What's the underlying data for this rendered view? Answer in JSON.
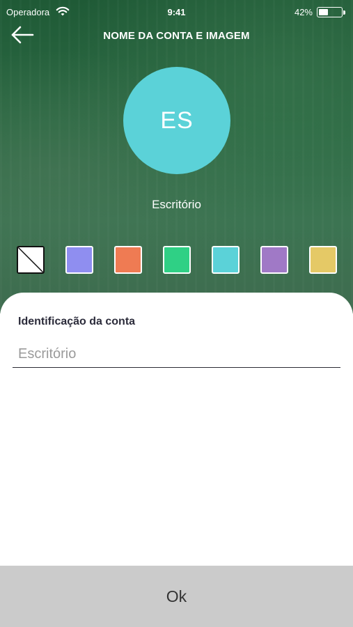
{
  "status_bar": {
    "carrier": "Operadora",
    "time": "9:41",
    "battery_percent": "42%",
    "battery_level": 0.42,
    "wifi_icon": "wifi-icon"
  },
  "header": {
    "back_icon": "arrow-left-icon",
    "title": "NOME DA CONTA E IMAGEM"
  },
  "avatar": {
    "initials": "ES",
    "color": "#5bd2d8"
  },
  "account_name": "Escritório",
  "colors": {
    "options": [
      {
        "name": "none",
        "hex": "#ffffff"
      },
      {
        "name": "periwinkle",
        "hex": "#8f8ef0"
      },
      {
        "name": "orange",
        "hex": "#ef7b53"
      },
      {
        "name": "green",
        "hex": "#2fd085"
      },
      {
        "name": "cyan",
        "hex": "#5bd2d8"
      },
      {
        "name": "purple",
        "hex": "#a079c6"
      },
      {
        "name": "yellow",
        "hex": "#e5c966"
      }
    ]
  },
  "form": {
    "label": "Identificação da conta",
    "value": "",
    "placeholder": "Escritório"
  },
  "footer": {
    "ok_label": "Ok"
  },
  "theme": {
    "header_green": "#1f5a36",
    "ok_bar_gray": "#cbcbcb"
  }
}
